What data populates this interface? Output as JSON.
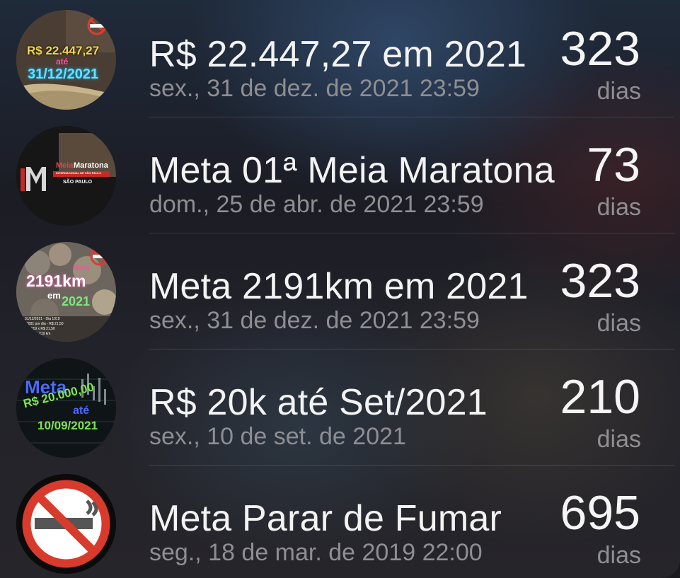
{
  "goals": [
    {
      "title": "R$ 22.447,27 em 2021",
      "date": "sex., 31 de dez. de 2021 23:59",
      "count": "323",
      "unit": "dias",
      "thumb": {
        "line1": "R$ 22.447,27",
        "line2": "até",
        "line3": "31/12/2021"
      }
    },
    {
      "title": "Meta 01ª Meia Maratona",
      "date": "dom., 25 de abr. de 2021 23:59",
      "count": "73",
      "unit": "dias",
      "thumb": {
        "brand_a": "Meia",
        "brand_b": "Maratona",
        "tagline": "INTERNACIONAL DE SÃO PAULO",
        "city": "SÃO PAULO"
      }
    },
    {
      "title": "Meta 2191km em 2021",
      "date": "sex., 31 de dez. de 2021 23:59",
      "count": "323",
      "unit": "dias",
      "thumb": {
        "line1": "Meta",
        "line2": "2191km",
        "line3": "em",
        "line4": "2021",
        "notes": [
          "31/12/2021 - Dia 1019",
          "1001 por dia - R$ 21,50",
          "1019 x R$ 21,50",
          "219 km"
        ]
      }
    },
    {
      "title": "R$ 20k até Set/2021",
      "date": "sex., 10 de set. de 2021",
      "count": "210",
      "unit": "dias",
      "thumb": {
        "line1": "Meta",
        "line2": "R$ 20.000,00",
        "line3": "até",
        "line4": "10/09/2021"
      }
    },
    {
      "title": "Meta Parar de Fumar",
      "date": "seg., 18 de mar. de 2019 22:00",
      "count": "695",
      "unit": "dias",
      "thumb": {
        "icon": "no-smoking-icon"
      }
    }
  ],
  "colors": {
    "title": "#f3f3f3",
    "secondary": "#8e8e93",
    "no_smoking_red": "#d83a2c"
  }
}
